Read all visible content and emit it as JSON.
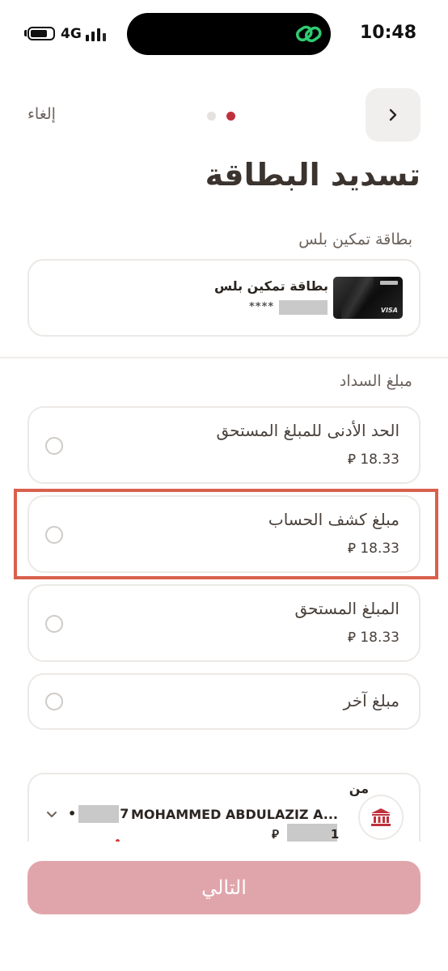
{
  "status_bar": {
    "network": "4G",
    "time": "10:48"
  },
  "header": {
    "cancel_label": "إلغاء",
    "back_icon": "chevron-right-icon",
    "steps_total": 2,
    "steps_current": 1
  },
  "page": {
    "title": "تسديد البطاقة"
  },
  "card_section": {
    "label": "بطاقة تمكين بلس",
    "card_name": "بطاقة تمكين بلس",
    "card_number": "****",
    "card_brand": "VISA"
  },
  "payment_section": {
    "label": "مبلغ السداد",
    "currency_symbol": "⃁",
    "options": [
      {
        "title": "الحد الأدنى للمبلغ المستحق",
        "amount": "18.33",
        "selected": false,
        "highlighted": false
      },
      {
        "title": "مبلغ كشف الحساب",
        "amount": "18.33",
        "selected": false,
        "highlighted": true
      },
      {
        "title": "المبلغ المستحق",
        "amount": "18.33",
        "selected": false,
        "highlighted": false
      },
      {
        "title": "مبلغ آخر",
        "amount": "",
        "selected": false,
        "highlighted": false
      }
    ]
  },
  "from_account": {
    "label": "من",
    "account_name": "MOHAMMED ABDULAZIZ A...",
    "account_number_prefix": "•",
    "account_number_suffix": "7",
    "balance_prefix": "⃁",
    "balance_suffix": "1"
  },
  "footer": {
    "next_label": "التالي"
  },
  "colors": {
    "accent": "#c0303c",
    "button_disabled": "#e0a5ab",
    "highlight": "#d9604d"
  }
}
